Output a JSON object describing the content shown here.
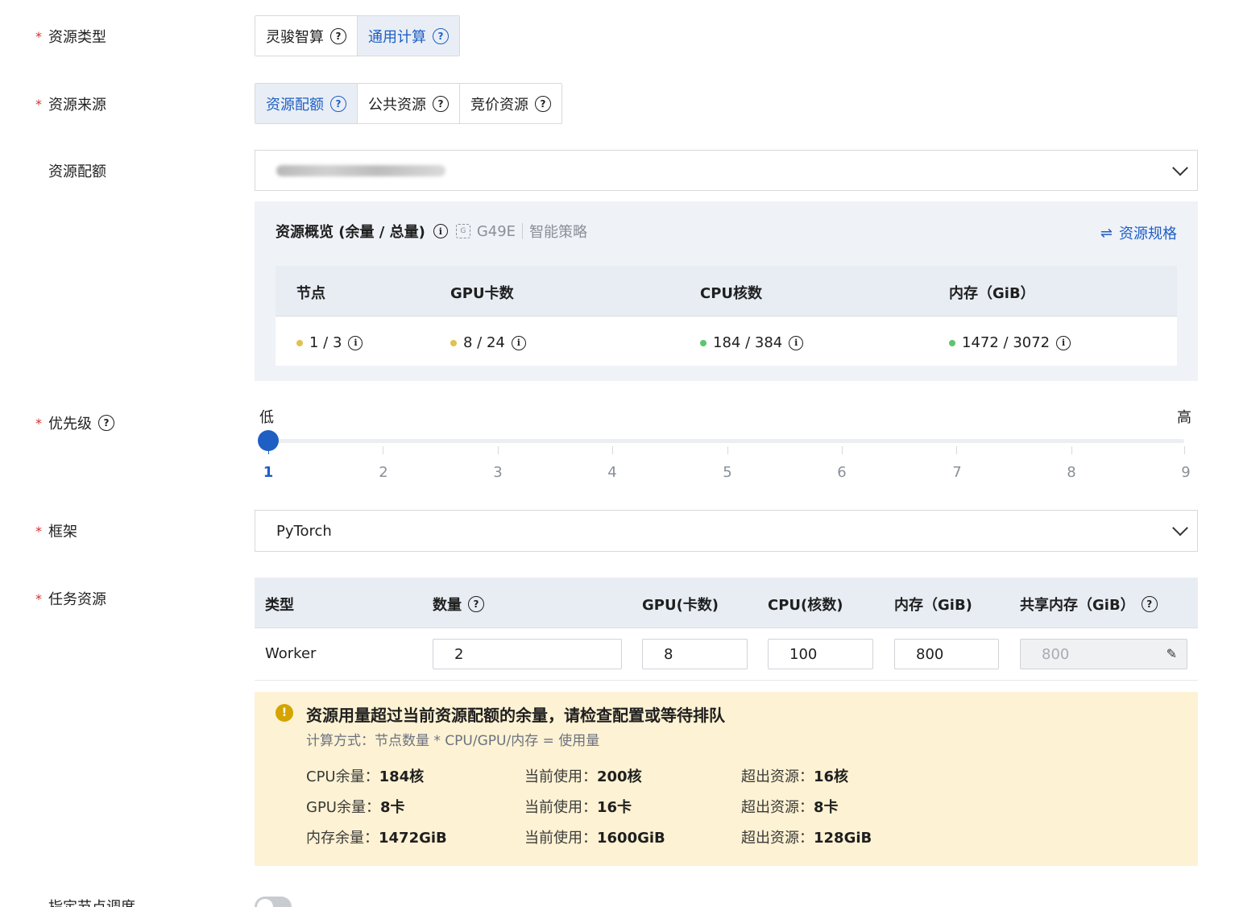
{
  "resource_type": {
    "label": "资源类型",
    "options": [
      "灵骏智算",
      "通用计算"
    ],
    "selected": "通用计算"
  },
  "resource_source": {
    "label": "资源来源",
    "options": [
      "资源配额",
      "公共资源",
      "竞价资源"
    ],
    "selected": "资源配额"
  },
  "resource_quota": {
    "label": "资源配额"
  },
  "overview": {
    "title": "资源概览 (余量 / 总量)",
    "gpu_model": "G49E",
    "strategy": "智能策略",
    "spec_link": "资源规格",
    "headers": [
      "节点",
      "GPU卡数",
      "CPU核数",
      "内存（GiB）"
    ],
    "values": [
      "1 / 3",
      "8 / 24",
      "184 / 384",
      "1472 / 3072"
    ],
    "status_colors": [
      "#e2c14e",
      "#e2c14e",
      "#5cc56f",
      "#5cc56f"
    ]
  },
  "priority": {
    "label": "优先级",
    "low": "低",
    "high": "高",
    "ticks": [
      "1",
      "2",
      "3",
      "4",
      "5",
      "6",
      "7",
      "8",
      "9"
    ],
    "value": 1
  },
  "framework": {
    "label": "框架",
    "value": "PyTorch"
  },
  "task_resource": {
    "label": "任务资源",
    "headers": [
      "类型",
      "数量",
      "GPU(卡数)",
      "CPU(核数)",
      "内存（GiB)",
      "共享内存（GiB）"
    ],
    "row": {
      "type": "Worker",
      "count": "2",
      "gpu": "8",
      "cpu": "100",
      "memory": "800",
      "shared_memory": "800"
    }
  },
  "alert": {
    "title": "资源用量超过当前资源配额的余量，请检查配置或等待排队",
    "formula": "计算方式：节点数量 * CPU/GPU/内存 = 使用量",
    "rows": [
      {
        "remain_label": "CPU余量：",
        "remain": "184核",
        "used_label": "当前使用：",
        "used": "200核",
        "over_label": "超出资源：",
        "over": "16核"
      },
      {
        "remain_label": "GPU余量：",
        "remain": "8卡",
        "used_label": "当前使用：",
        "used": "16卡",
        "over_label": "超出资源：",
        "over": "8卡"
      },
      {
        "remain_label": "内存余量：",
        "remain": "1472GiB",
        "used_label": "当前使用：",
        "used": "1600GiB",
        "over_label": "超出资源：",
        "over": "128GiB"
      }
    ]
  },
  "node_schedule": {
    "label": "指定节点调度"
  },
  "colors": {
    "accent": "#1e5fc4",
    "required": "#d43030",
    "alert_bg": "#fdf2d3",
    "alert_icon": "#d4a400"
  }
}
